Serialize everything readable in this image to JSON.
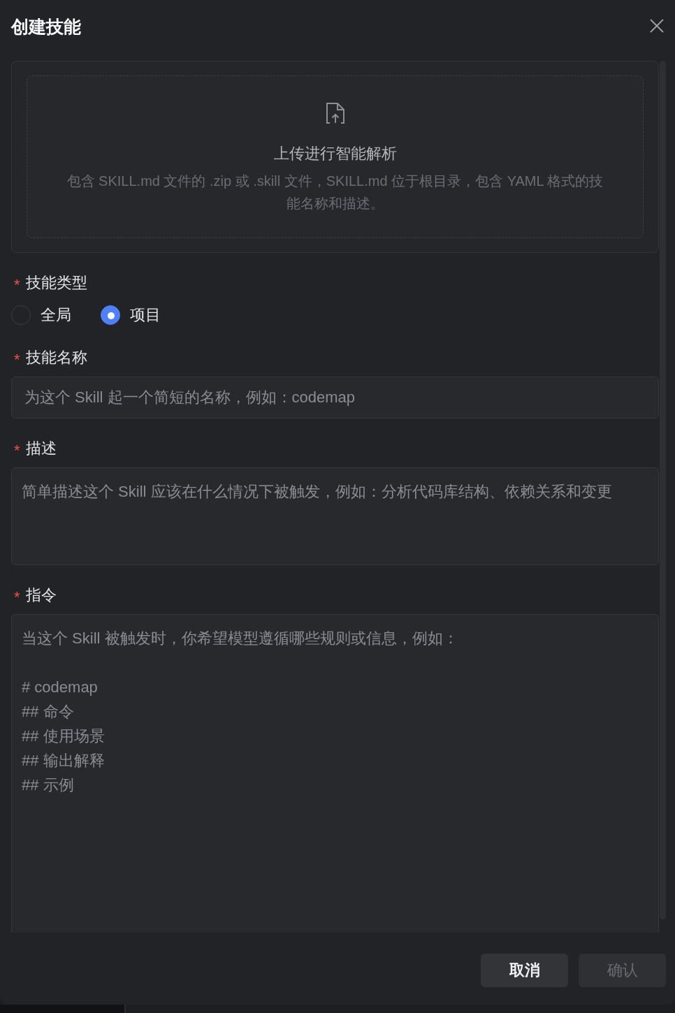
{
  "dialog": {
    "title": "创建技能"
  },
  "upload": {
    "title": "上传进行智能解析",
    "description": "包含 SKILL.md 文件的 .zip 或 .skill 文件，SKILL.md 位于根目录，包含 YAML 格式的技能名称和描述。"
  },
  "fields": [
    {
      "kind": "radio",
      "required_mark": "*",
      "label": "技能类型",
      "options": [
        {
          "label": "全局",
          "selected": false
        },
        {
          "label": "项目",
          "selected": true
        }
      ]
    },
    {
      "kind": "input",
      "required_mark": "*",
      "label": "技能名称",
      "placeholder": "为这个 Skill 起一个简短的名称，例如：codemap"
    },
    {
      "kind": "textarea",
      "required_mark": "*",
      "label": "描述",
      "placeholder": "简单描述这个 Skill 应该在什么情况下被触发，例如：分析代码库结构、依赖关系和变更"
    },
    {
      "kind": "textarea",
      "required_mark": "*",
      "label": "指令",
      "placeholder": "当这个 Skill 被触发时，你希望模型遵循哪些规则或信息，例如：\n\n# codemap\n## 命令\n## 使用场景\n## 输出解释\n## 示例"
    }
  ],
  "buttons": [
    {
      "label": "取消",
      "disabled": false
    },
    {
      "label": "确认",
      "disabled": true
    }
  ]
}
